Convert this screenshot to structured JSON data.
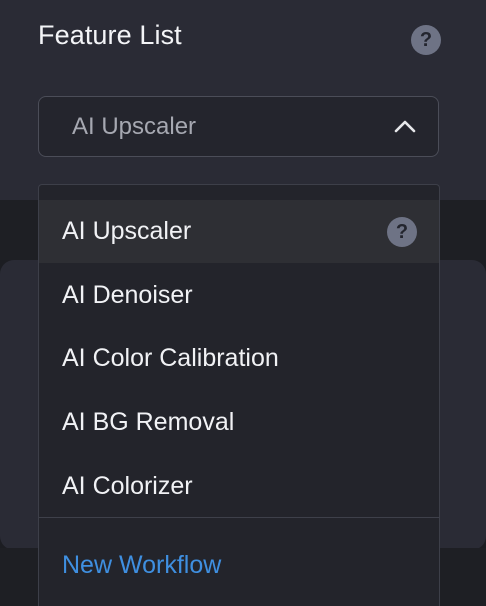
{
  "panel": {
    "title": "Feature List",
    "help_glyph": "?"
  },
  "select": {
    "value": "AI Upscaler",
    "icon": "chevron-up-icon"
  },
  "dropdown": {
    "items": [
      {
        "label": "AI Upscaler",
        "selected": true,
        "help_glyph": "?"
      },
      {
        "label": "AI Denoiser"
      },
      {
        "label": "AI Color Calibration"
      },
      {
        "label": "AI BG Removal"
      },
      {
        "label": "AI Colorizer"
      }
    ],
    "action_label": "New Workflow"
  },
  "colors": {
    "panel_bg": "#2a2b35",
    "dropdown_bg": "#23242b",
    "link": "#3f8fe0",
    "help_circle": "#6e7385"
  }
}
